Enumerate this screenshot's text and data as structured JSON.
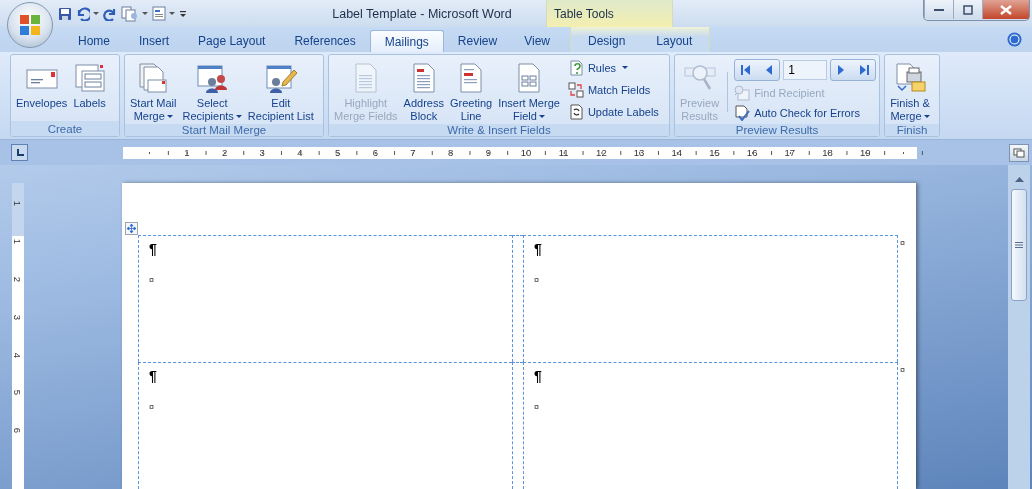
{
  "window": {
    "title": "Label Template - Microsoft Word",
    "contextual_title": "Table Tools"
  },
  "tabs": [
    {
      "label": "Home",
      "selected": false,
      "contextual": false
    },
    {
      "label": "Insert",
      "selected": false,
      "contextual": false
    },
    {
      "label": "Page Layout",
      "selected": false,
      "contextual": false
    },
    {
      "label": "References",
      "selected": false,
      "contextual": false
    },
    {
      "label": "Mailings",
      "selected": true,
      "contextual": false
    },
    {
      "label": "Review",
      "selected": false,
      "contextual": false
    },
    {
      "label": "View",
      "selected": false,
      "contextual": false
    },
    {
      "label": "Design",
      "selected": false,
      "contextual": true
    },
    {
      "label": "Layout",
      "selected": false,
      "contextual": true
    }
  ],
  "ribbon": {
    "groups": [
      {
        "title": "Create",
        "items": [
          {
            "kind": "large",
            "lines": [
              "Envelopes"
            ],
            "dropdown": false,
            "disabled": false
          },
          {
            "kind": "large",
            "lines": [
              "Labels"
            ],
            "dropdown": false,
            "disabled": false
          }
        ]
      },
      {
        "title": "Start Mail Merge",
        "items": [
          {
            "kind": "large",
            "lines": [
              "Start Mail",
              "Merge"
            ],
            "dropdown": true,
            "disabled": false
          },
          {
            "kind": "large",
            "lines": [
              "Select",
              "Recipients"
            ],
            "dropdown": true,
            "disabled": false
          },
          {
            "kind": "large",
            "lines": [
              "Edit",
              "Recipient List"
            ],
            "dropdown": false,
            "disabled": false
          }
        ]
      },
      {
        "title": "Write & Insert Fields",
        "items": [
          {
            "kind": "large",
            "lines": [
              "Highlight",
              "Merge Fields"
            ],
            "dropdown": false,
            "disabled": true
          },
          {
            "kind": "large",
            "lines": [
              "Address",
              "Block"
            ],
            "dropdown": false,
            "disabled": false
          },
          {
            "kind": "large",
            "lines": [
              "Greeting",
              "Line"
            ],
            "dropdown": false,
            "disabled": false
          },
          {
            "kind": "large",
            "lines": [
              "Insert Merge",
              "Field"
            ],
            "dropdown": true,
            "disabled": false
          },
          {
            "kind": "stack",
            "items": [
              {
                "label": "Rules",
                "dropdown": true,
                "disabled": false
              },
              {
                "label": "Match Fields",
                "dropdown": false,
                "disabled": false
              },
              {
                "label": "Update Labels",
                "dropdown": false,
                "disabled": false
              }
            ]
          }
        ]
      },
      {
        "title": "Preview Results",
        "items": [
          {
            "kind": "large",
            "lines": [
              "Preview",
              "Results"
            ],
            "dropdown": false,
            "disabled": true
          },
          {
            "kind": "navigator",
            "record": "1",
            "items": [
              {
                "label": "Find Recipient",
                "dropdown": false,
                "disabled": true
              },
              {
                "label": "Auto Check for Errors",
                "dropdown": false,
                "disabled": false
              }
            ]
          }
        ]
      },
      {
        "title": "Finish",
        "items": [
          {
            "kind": "large",
            "lines": [
              "Finish &",
              "Merge"
            ],
            "dropdown": true,
            "disabled": false
          }
        ]
      }
    ]
  },
  "ruler": {
    "horizontal": [
      "1",
      "2",
      "3",
      "4",
      "5",
      "6",
      "7",
      "8",
      "9",
      "10",
      "11",
      "12",
      "13",
      "14",
      "15",
      "16",
      "17",
      "18",
      "19"
    ],
    "vertical": [
      "1",
      "1",
      "2",
      "3",
      "4",
      "5",
      "6"
    ]
  },
  "table": {
    "rows": [
      {
        "cells": [
          {
            "paragraph_mark": "¶",
            "cell_mark": "¤"
          },
          {
            "paragraph_mark": "¶",
            "cell_mark": "¤"
          }
        ],
        "row_mark": "¤"
      },
      {
        "cells": [
          {
            "paragraph_mark": "¶",
            "cell_mark": "¤"
          },
          {
            "paragraph_mark": "¶",
            "cell_mark": "¤"
          }
        ],
        "row_mark": "¤"
      }
    ]
  }
}
